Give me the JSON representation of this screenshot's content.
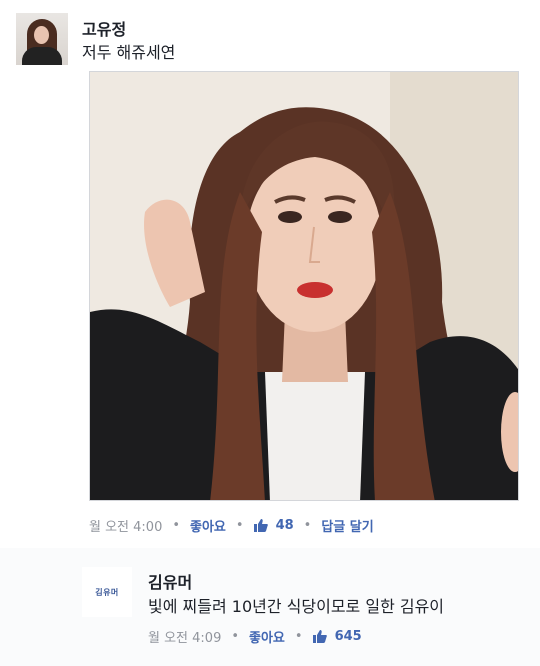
{
  "post": {
    "author": "고유정",
    "message": "저두 해쥬세연",
    "timestamp": "월 오전 4:00",
    "like_label": "좋아요",
    "like_count": "48",
    "reply_label": "답글 달기"
  },
  "reply": {
    "avatar_text": "김유머",
    "author": "김유머",
    "message": "빛에 찌들려 10년간 식당이모로 일한 김유이",
    "timestamp": "월 오전 4:09",
    "like_label": "좋아요",
    "like_count": "645"
  },
  "colors": {
    "link": "#4267b2",
    "meta": "#90949c",
    "text": "#1d2129"
  }
}
